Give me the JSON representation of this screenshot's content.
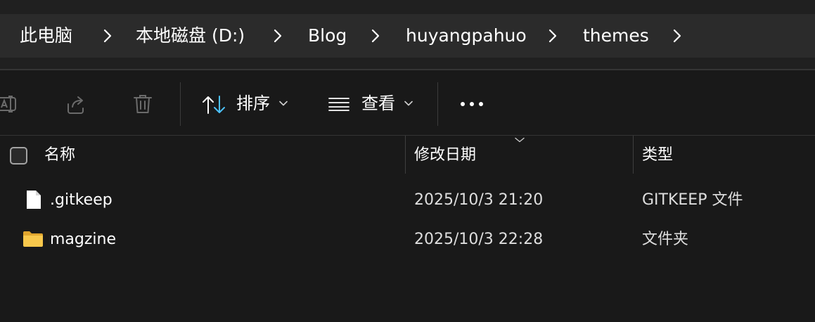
{
  "breadcrumb": [
    {
      "label": "此电脑"
    },
    {
      "label": "本地磁盘 (D:)"
    },
    {
      "label": "Blog"
    },
    {
      "label": "huyangpahuo"
    },
    {
      "label": "themes"
    }
  ],
  "toolbar": {
    "rename_icon": "rename-icon",
    "share_icon": "share-icon",
    "delete_icon": "trash-icon",
    "sort_label": "排序",
    "view_label": "查看",
    "more_icon": "more-horizontal-icon"
  },
  "columns": {
    "name": "名称",
    "date": "修改日期",
    "type": "类型"
  },
  "files": [
    {
      "name": ".gitkeep",
      "date": "2025/10/3 21:20",
      "type": "GITKEEP 文件",
      "icon": "file-icon"
    },
    {
      "name": "magzine",
      "date": "2025/10/3 22:28",
      "type": "文件夹",
      "icon": "folder-icon"
    }
  ],
  "colors": {
    "accent": "#4cc2ff",
    "folder": "#f8c84c",
    "background": "#191919"
  }
}
